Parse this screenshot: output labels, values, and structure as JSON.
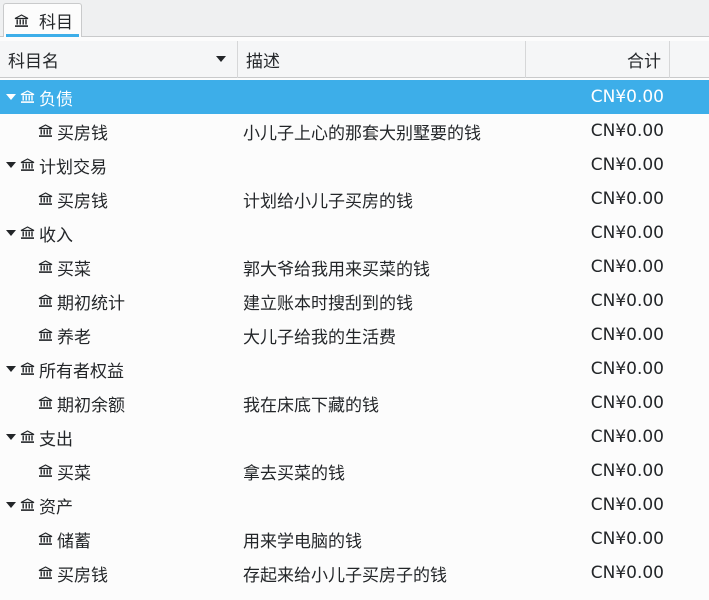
{
  "tab": {
    "label": "科目"
  },
  "columns": {
    "name": "科目名",
    "description": "描述",
    "total": "合计"
  },
  "accent_color": "#3daee9",
  "rows": [
    {
      "name": "负债",
      "description": "",
      "total": "CN¥0.00"
    },
    {
      "name": "买房钱",
      "description": "小儿子上心的那套大别墅要的钱",
      "total": "CN¥0.00"
    },
    {
      "name": "计划交易",
      "description": "",
      "total": "CN¥0.00"
    },
    {
      "name": "买房钱",
      "description": "计划给小儿子买房的钱",
      "total": "CN¥0.00"
    },
    {
      "name": "收入",
      "description": "",
      "total": "CN¥0.00"
    },
    {
      "name": "买菜",
      "description": "郭大爷给我用来买菜的钱",
      "total": "CN¥0.00"
    },
    {
      "name": "期初统计",
      "description": "建立账本时搜刮到的钱",
      "total": "CN¥0.00"
    },
    {
      "name": "养老",
      "description": "大儿子给我的生活费",
      "total": "CN¥0.00"
    },
    {
      "name": "所有者权益",
      "description": "",
      "total": "CN¥0.00"
    },
    {
      "name": "期初余额",
      "description": "我在床底下藏的钱",
      "total": "CN¥0.00"
    },
    {
      "name": "支出",
      "description": "",
      "total": "CN¥0.00"
    },
    {
      "name": "买菜",
      "description": "拿去买菜的钱",
      "total": "CN¥0.00"
    },
    {
      "name": "资产",
      "description": "",
      "total": "CN¥0.00"
    },
    {
      "name": "储蓄",
      "description": "用来学电脑的钱",
      "total": "CN¥0.00"
    },
    {
      "name": "买房钱",
      "description": "存起来给小儿子买房子的钱",
      "total": "CN¥0.00"
    }
  ]
}
